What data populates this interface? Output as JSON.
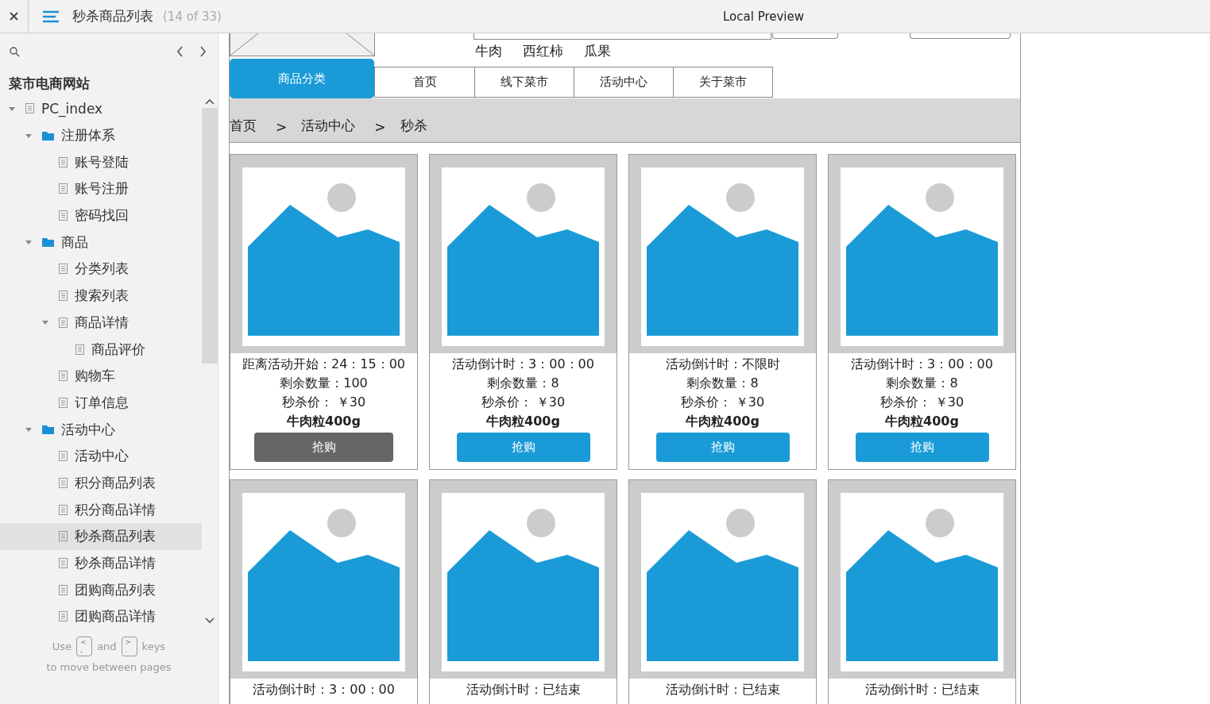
{
  "topbar": {
    "title": "秒杀商品列表",
    "page_count": "(14 of 33)",
    "preview_label": "Local Preview"
  },
  "sidebar": {
    "site_title": "菜市电商网站",
    "tree": [
      {
        "label": "PC_index",
        "kind": "page",
        "expanded": true,
        "selected": false,
        "children": [
          {
            "label": "注册体系",
            "kind": "folder",
            "expanded": true,
            "selected": false,
            "children": [
              {
                "label": "账号登陆",
                "kind": "page",
                "selected": false
              },
              {
                "label": "账号注册",
                "kind": "page",
                "selected": false
              },
              {
                "label": "密码找回",
                "kind": "page",
                "selected": false
              }
            ]
          },
          {
            "label": "商品",
            "kind": "folder",
            "expanded": true,
            "selected": false,
            "children": [
              {
                "label": "分类列表",
                "kind": "page",
                "selected": false
              },
              {
                "label": "搜索列表",
                "kind": "page",
                "selected": false
              },
              {
                "label": "商品详情",
                "kind": "page",
                "expanded": true,
                "selected": false,
                "children": [
                  {
                    "label": "商品评价",
                    "kind": "page",
                    "selected": false
                  }
                ]
              },
              {
                "label": "购物车",
                "kind": "page",
                "selected": false
              },
              {
                "label": "订单信息",
                "kind": "page",
                "selected": false
              }
            ]
          },
          {
            "label": "活动中心",
            "kind": "folder",
            "expanded": true,
            "selected": false,
            "children": [
              {
                "label": "活动中心",
                "kind": "page",
                "selected": false
              },
              {
                "label": "积分商品列表",
                "kind": "page",
                "selected": false
              },
              {
                "label": "积分商品详情",
                "kind": "page",
                "selected": false
              },
              {
                "label": "秒杀商品列表",
                "kind": "page",
                "selected": true
              },
              {
                "label": "秒杀商品详情",
                "kind": "page",
                "selected": false
              },
              {
                "label": "团购商品列表",
                "kind": "page",
                "selected": false
              },
              {
                "label": "团购商品详情",
                "kind": "page",
                "selected": false
              }
            ]
          }
        ]
      }
    ],
    "hint": {
      "use": "Use",
      "prev_key": [
        "<",
        ","
      ],
      "and": "and",
      "next_key": [
        ">",
        "."
      ],
      "keys": "keys",
      "line2": "to move between pages"
    }
  },
  "page": {
    "hot_words": [
      "牛肉",
      "西红柿",
      "瓜果"
    ],
    "category_button": "商品分类",
    "nav_tabs": [
      {
        "label": "首页"
      },
      {
        "label": "线下菜市"
      },
      {
        "label": "活动中心"
      },
      {
        "label": "关于菜市"
      }
    ],
    "breadcrumb": [
      {
        "label": "首页"
      },
      {
        "label": ">"
      },
      {
        "label": "活动中心"
      },
      {
        "label": ">"
      },
      {
        "label": "秒杀"
      }
    ],
    "products": [
      {
        "timer": "距离活动开始：24：15：00",
        "stock": "剩余数量：100",
        "price": "秒杀价： ￥30",
        "name": "牛肉粒400g",
        "button": {
          "label": "抢购",
          "disabled": true
        }
      },
      {
        "timer": "活动倒计时：3：00：00",
        "stock": "剩余数量：8",
        "price": "秒杀价： ￥30",
        "name": "牛肉粒400g",
        "button": {
          "label": "抢购",
          "disabled": false
        }
      },
      {
        "timer": "活动倒计时：不限时",
        "stock": "剩余数量：8",
        "price": "秒杀价： ￥30",
        "name": "牛肉粒400g",
        "button": {
          "label": "抢购",
          "disabled": false
        }
      },
      {
        "timer": "活动倒计时：3：00：00",
        "stock": "剩余数量：8",
        "price": "秒杀价： ￥30",
        "name": "牛肉粒400g",
        "button": {
          "label": "抢购",
          "disabled": false
        }
      },
      {
        "timer": "活动倒计时：3：00：00"
      },
      {
        "timer": "活动倒计时：已结束"
      },
      {
        "timer": "活动倒计时：已结束"
      },
      {
        "timer": "活动倒计时：已结束"
      }
    ]
  }
}
